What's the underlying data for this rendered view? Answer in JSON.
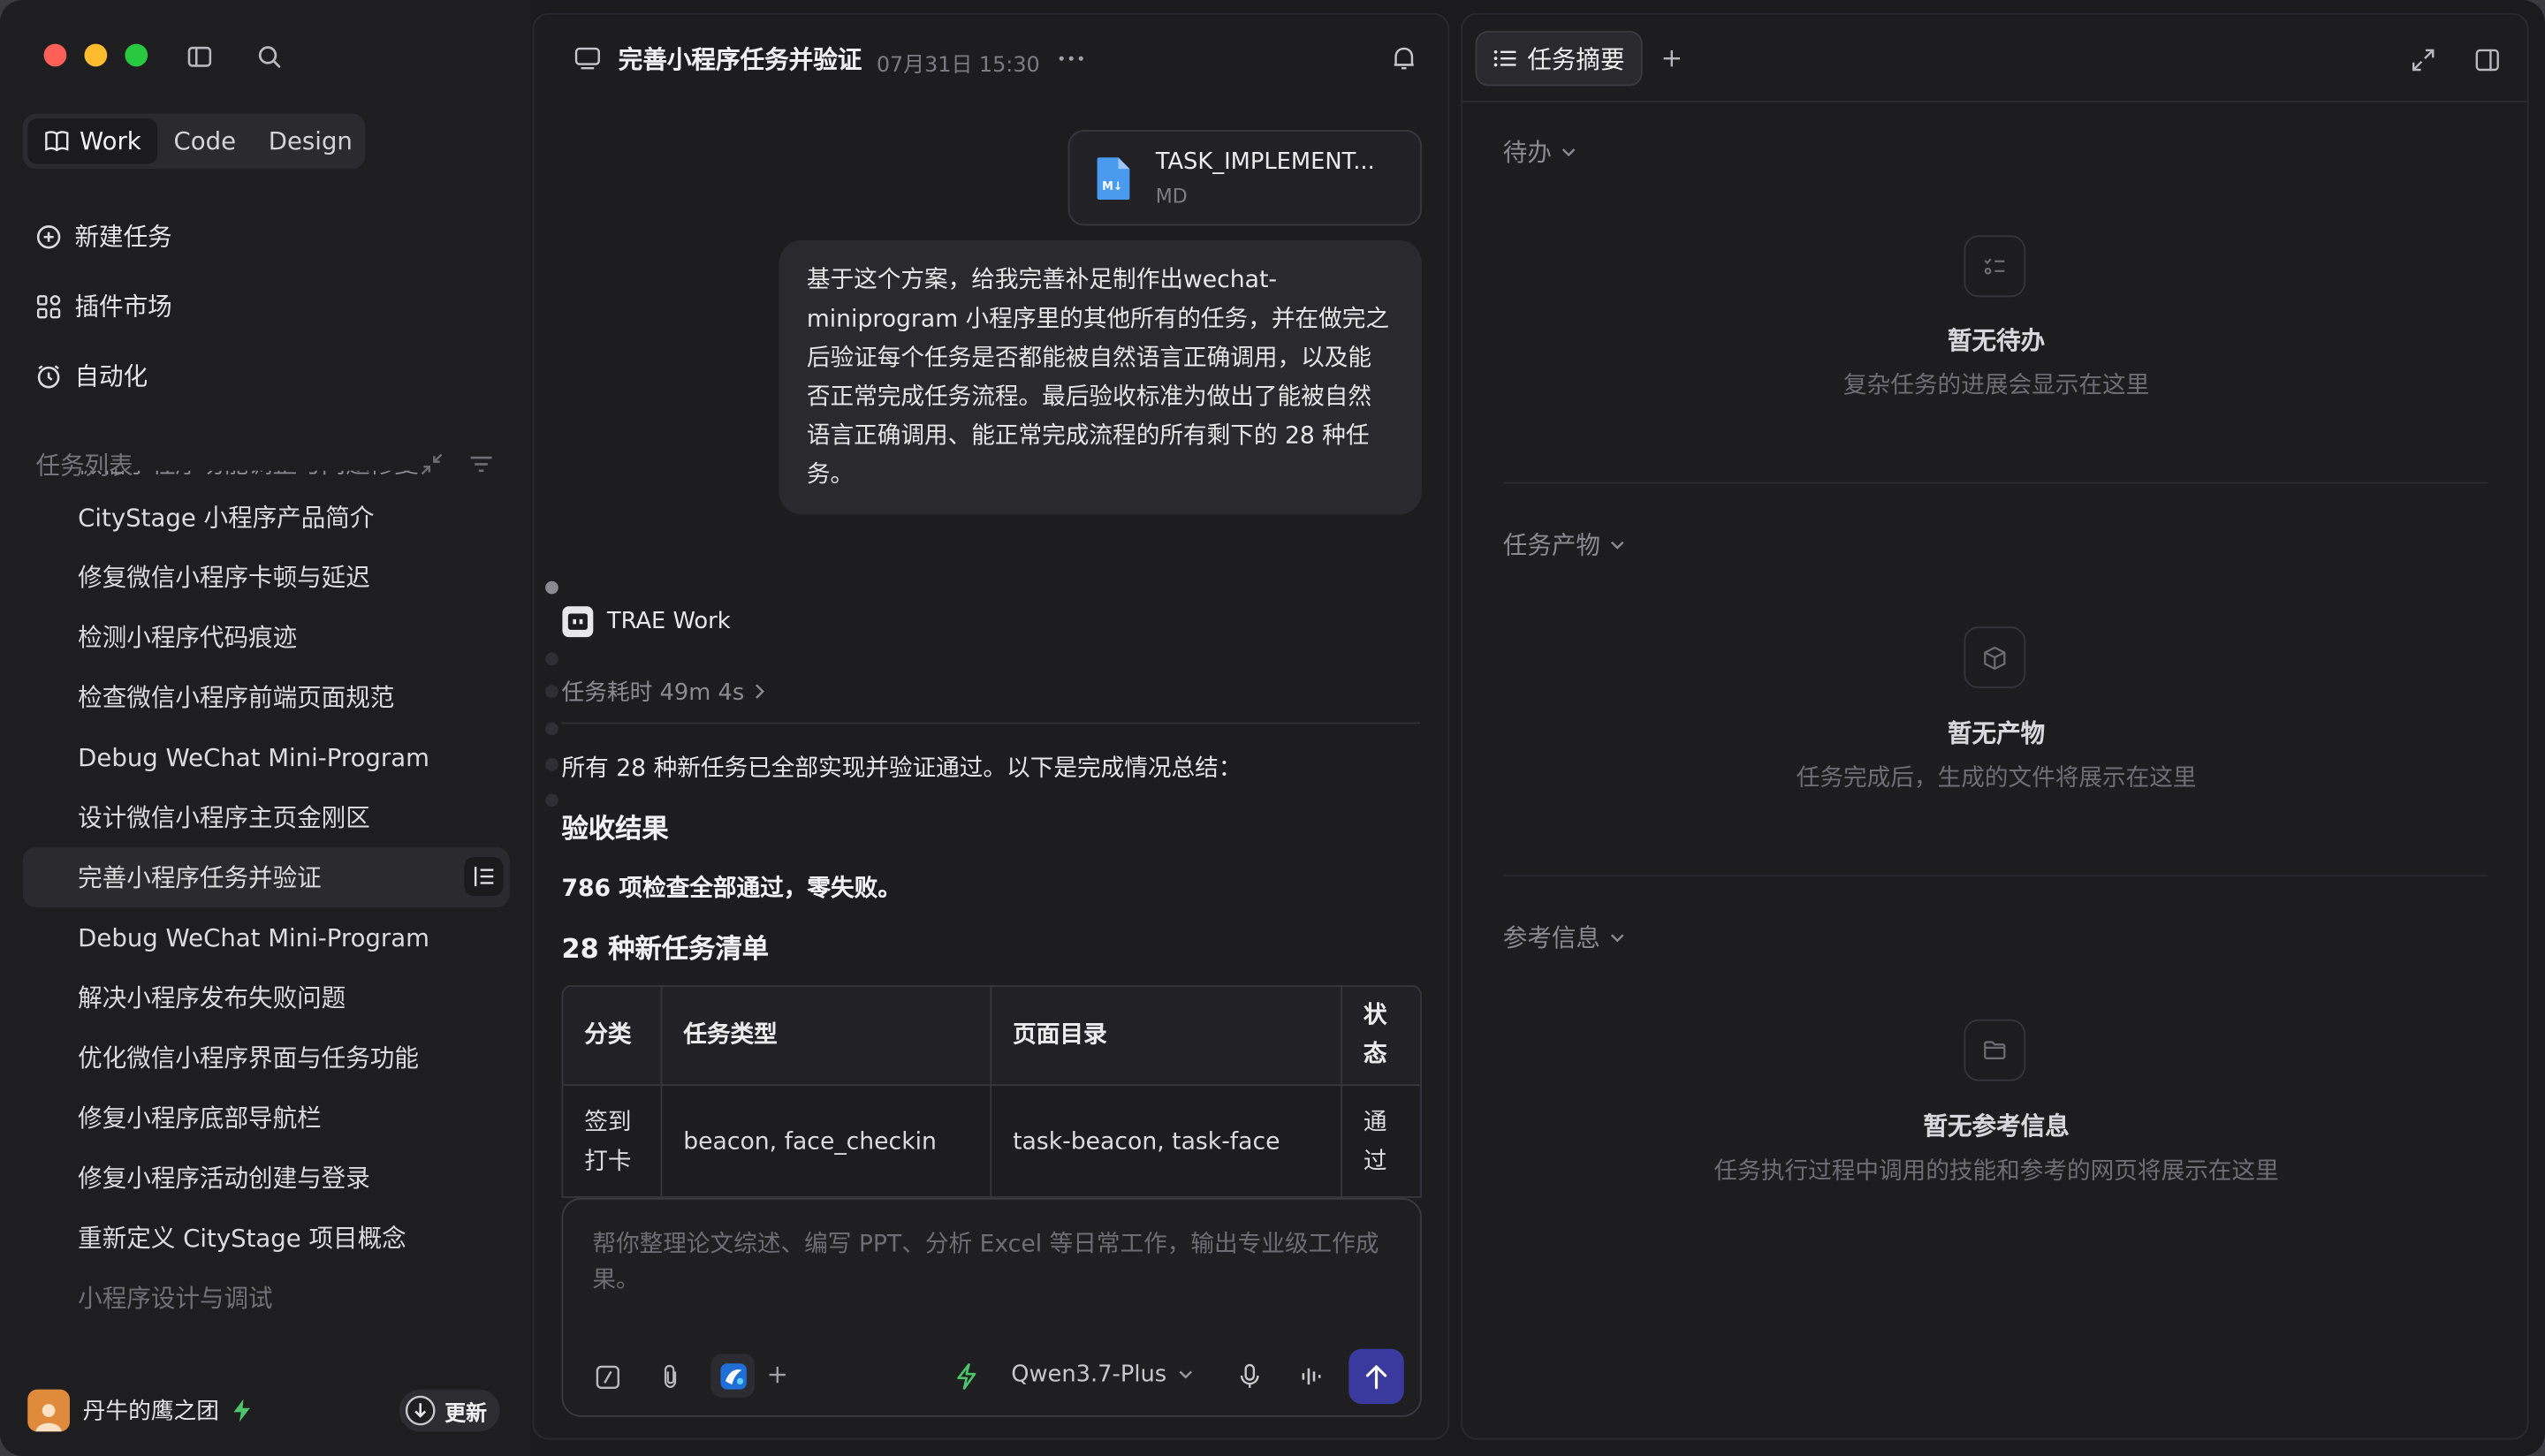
{
  "sidebar": {
    "modes": [
      "Work",
      "Code",
      "Design"
    ],
    "nav": {
      "new_task": "新建任务",
      "plugin_market": "插件市场",
      "automation": "自动化"
    },
    "task_list_title": "任务列表",
    "task_cut": "微信小程序功能调整与问题修复",
    "tasks": [
      "CityStage 小程序产品简介",
      "修复微信小程序卡顿与延迟",
      "检测小程序代码痕迹",
      "检查微信小程序前端页面规范",
      "Debug WeChat Mini-Program",
      "设计微信小程序主页金刚区",
      "完善小程序任务并验证",
      "Debug WeChat Mini-Program",
      "解决小程序发布失败问题",
      "优化微信小程序界面与任务功能",
      "修复小程序底部导航栏",
      "修复小程序活动创建与登录",
      "重新定义 CityStage 项目概念",
      "小程序设计与调试"
    ],
    "user_name": "丹牛的鹰之团",
    "update_label": "更新"
  },
  "chat": {
    "title": "完善小程序任务并验证",
    "time": "07月31日 15:30",
    "file_name": "TASK_IMPLEMENT...",
    "file_type": "MD",
    "user_message": "基于这个方案，给我完善补足制作出wechat-miniprogram 小程序里的其他所有的任务，并在做完之后验证每个任务是否都能被自然语言正确调用，以及能否正常完成任务流程。最后验收标准为做出了能被自然语言正确调用、能正常完成流程的所有剩下的 28 种任务。",
    "agent_name": "TRAE Work",
    "elapsed": "任务耗时 49m 4s",
    "summary": "所有 28 种新任务已全部实现并验证通过。以下是完成情况总结：",
    "heading_result": "验收结果",
    "result_line": "786 项检查全部通过，零失败。",
    "heading_list": "28 种新任务清单",
    "table": {
      "headers": [
        "分类",
        "任务类型",
        "页面目录",
        "状态"
      ],
      "rows": [
        [
          "签到打卡",
          "beacon, face_checkin",
          "task-beacon, task-face",
          "通过"
        ]
      ]
    },
    "placeholder": "帮你整理论文综述、编写 PPT、分析 Excel 等日常工作，输出专业级工作成果。",
    "model": "Qwen3.7-Plus"
  },
  "panel": {
    "tab_label": "任务摘要",
    "sections": [
      {
        "title": "待办",
        "empty_title": "暂无待办",
        "empty_sub": "复杂任务的进展会显示在这里"
      },
      {
        "title": "任务产物",
        "empty_title": "暂无产物",
        "empty_sub": "任务完成后，生成的文件将展示在这里"
      },
      {
        "title": "参考信息",
        "empty_title": "暂无参考信息",
        "empty_sub": "任务执行过程中调用的技能和参考的网页将展示在这里"
      }
    ]
  },
  "colors": {
    "close": "#fe5f57",
    "minimize": "#febc2e",
    "zoom": "#28c840",
    "accent": "#3a3a9e",
    "bolt": "#4cc46a"
  }
}
